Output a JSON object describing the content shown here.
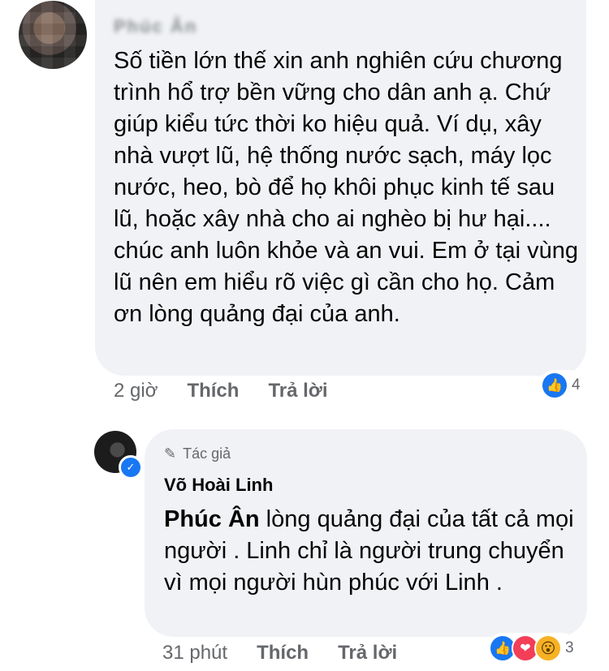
{
  "comment": {
    "author_name": "Phúc Ân",
    "text": "Số tiền lớn thế xin anh nghiên cứu chương trình hổ trợ bền vững cho dân anh ạ. Chứ giúp kiểu tức thời ko hiệu quả. Ví dụ, xây nhà vượt lũ, hệ thống nước sạch, máy lọc nước, heo, bò để họ khôi phục kinh tế sau lũ, hoặc xây nhà cho ai nghèo bị hư hại.... chúc anh luôn khỏe và an vui. Em ở tại vùng lũ nên em hiểu rõ việc gì cần cho họ. Cảm ơn lòng quảng đại của anh.",
    "time": "2 giờ",
    "like_label": "Thích",
    "reply_label": "Trả lời",
    "reaction_count": "4",
    "reactions": [
      "like-icon"
    ]
  },
  "reply": {
    "author_badge": "Tác giả",
    "author_name": "Võ Hoài Linh",
    "mention": "Phúc Ân",
    "text": " lòng quảng đại của tất cả mọi người . Linh chỉ là người trung chuyển vì mọi người hùn phúc với Linh .",
    "time": "31 phút",
    "like_label": "Thích",
    "reply_label": "Trả lời",
    "reaction_count": "3",
    "reactions": [
      "like-icon",
      "love-icon",
      "wow-icon"
    ]
  },
  "colors": {
    "bubble": "#f0f2f5",
    "meta_text": "#65676b",
    "like_blue": "#1877f2",
    "love_red": "#f33e58",
    "wow_yellow": "#f7b125"
  }
}
